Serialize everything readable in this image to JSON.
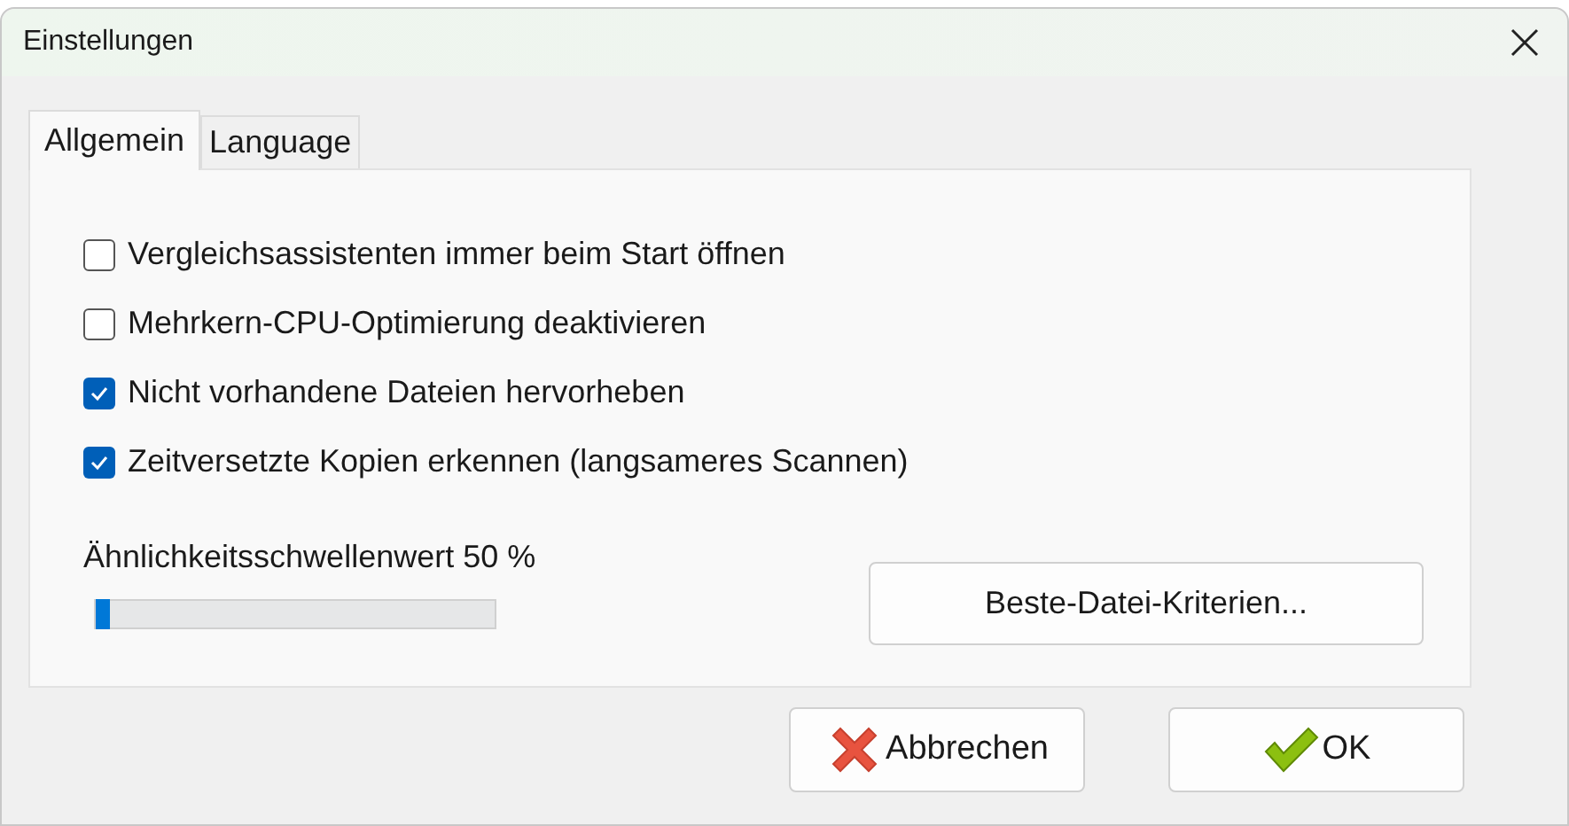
{
  "window": {
    "title": "Einstellungen"
  },
  "tabs": [
    {
      "label": "Allgemein",
      "selected": true
    },
    {
      "label": "Language",
      "selected": false
    }
  ],
  "options": [
    {
      "label": "Vergleichsassistenten immer beim Start öffnen",
      "checked": false
    },
    {
      "label": "Mehrkern-CPU-Optimierung deaktivieren",
      "checked": false
    },
    {
      "label": "Nicht vorhandene Dateien hervorheben",
      "checked": true
    },
    {
      "label": "Zeitversetzte Kopien erkennen (langsameres Scannen)",
      "checked": true
    }
  ],
  "threshold": {
    "label": "Ähnlichkeitsschwellenwert 50 %",
    "level": 0
  },
  "criteria_button": "Beste-Datei-Kriterien...",
  "buttons": [
    {
      "label": "Abbrechen",
      "kind": "cancel"
    },
    {
      "label": "OK",
      "kind": "ok"
    }
  ]
}
